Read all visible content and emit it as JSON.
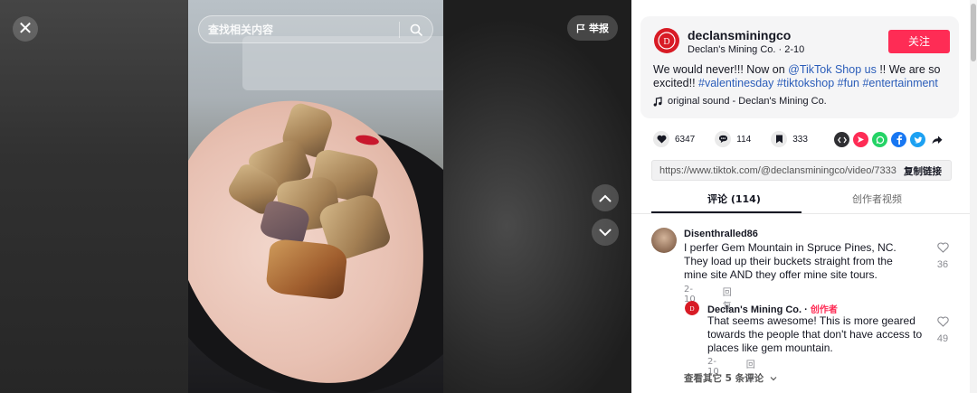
{
  "search": {
    "placeholder": "查找相关内容"
  },
  "report": {
    "label": "举报"
  },
  "author": {
    "handle": "declansminingco",
    "display_name": "Declan's Mining Co.",
    "date": "2-10",
    "follow_label": "关注"
  },
  "caption": {
    "text_start": "We would never!!! Now on ",
    "mention": "@TikTok Shop us",
    "text_mid": " !! We are so excited!! ",
    "tags": [
      "#valentinesday",
      "#tiktokshop",
      "#fun",
      "#entertainment"
    ]
  },
  "sound": {
    "label": "original sound - Declan's Mining Co."
  },
  "stats": {
    "likes": "6347",
    "comments": "114",
    "saves": "333"
  },
  "share_icons": [
    "embed-icon",
    "send-icon",
    "whatsapp-icon",
    "facebook-icon",
    "twitter-icon",
    "share-arrow-icon"
  ],
  "link": {
    "url": "https://www.tiktok.com/@declansminingco/video/7333...",
    "copy_label": "复制链接"
  },
  "tabs": {
    "comments": "评论 (114)",
    "creator_videos": "创作者视频"
  },
  "comments": [
    {
      "user": "Disenthralled86",
      "text": "I perfer Gem Mountain in Spruce Pines, NC. They load up their buckets straight from the mine site AND they offer mine site tours.",
      "date": "2-10",
      "reply_label": "回复",
      "likes": "36"
    }
  ],
  "reply": {
    "user": "Declan's Mining Co.",
    "separator": " · ",
    "creator_tag": "创作者",
    "text": "That seems awesome! This is more geared towards the people that don't have access to places like gem mountain.",
    "date": "2-10",
    "reply_label": "回复",
    "likes": "49"
  },
  "view_more": "查看其它 5 条评论",
  "colors": {
    "brand": "#fe2c55",
    "hashtag": "#2b5db9"
  }
}
